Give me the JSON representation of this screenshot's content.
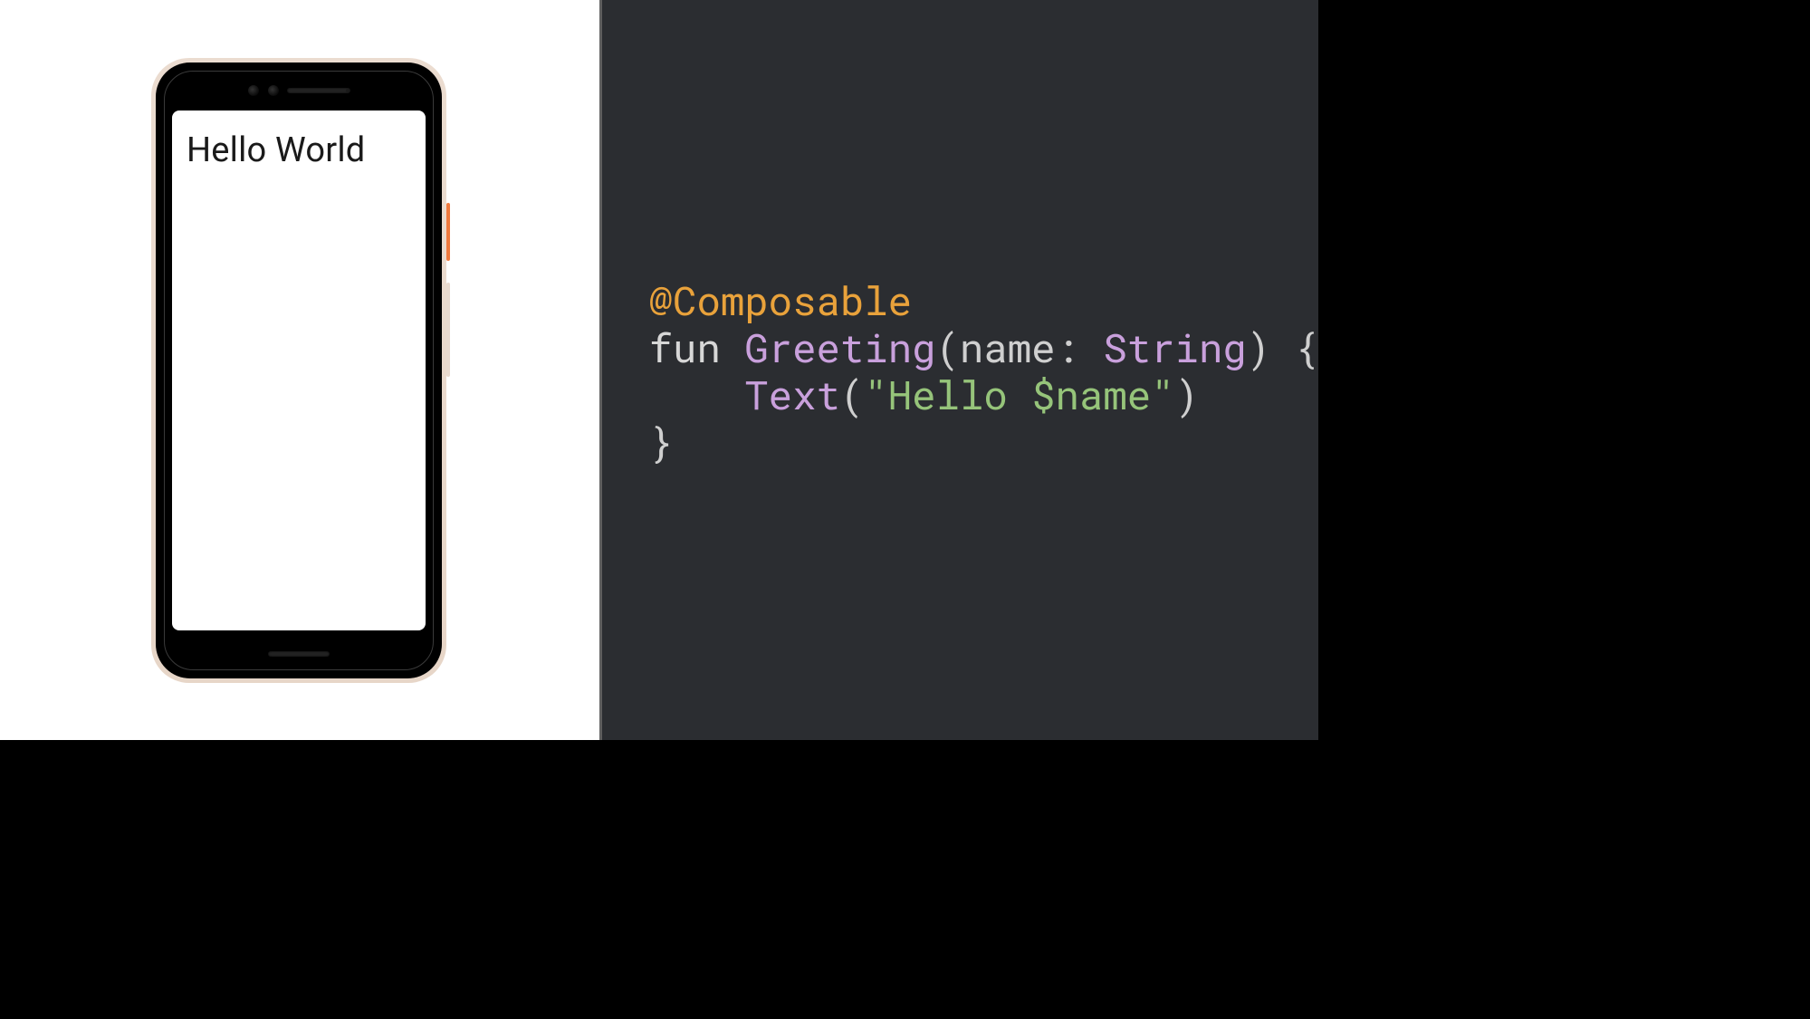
{
  "phone": {
    "screen_text": "Hello World"
  },
  "code": {
    "annotation": "@Composable",
    "kw_fun": "fun",
    "fn_name": "Greeting",
    "open_paren": "(",
    "param_name": "name",
    "colon_space": ": ",
    "param_type": "String",
    "close_paren_brace": ") {",
    "indent": "    ",
    "call_name": "Text",
    "call_open": "(",
    "string_literal": "\"Hello $name\"",
    "call_close": ")",
    "brace_close": "}"
  }
}
